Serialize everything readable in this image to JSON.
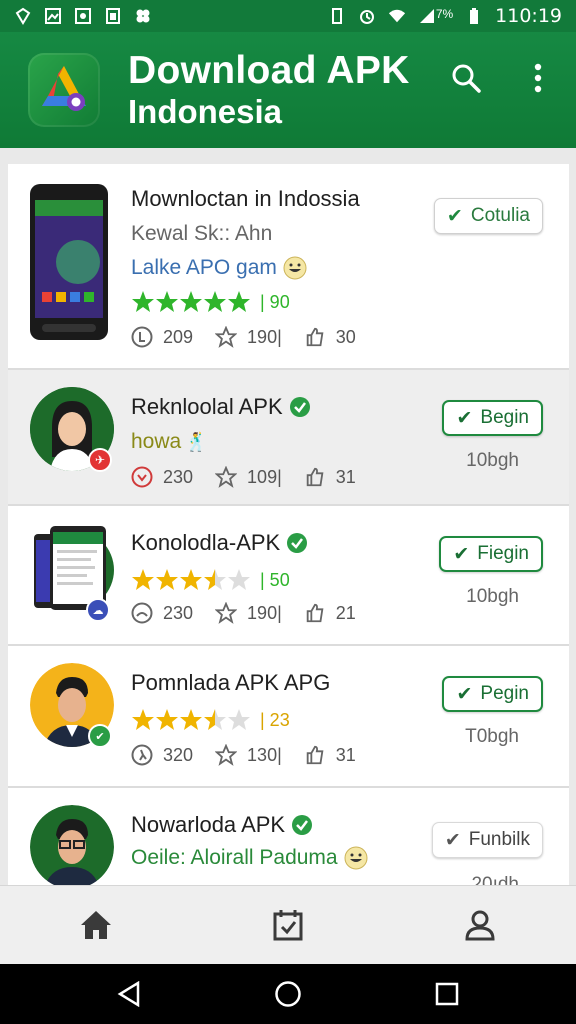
{
  "status_bar": {
    "battery_percent": "7%",
    "time": "110:19"
  },
  "app_bar": {
    "title_line1": "Download APK",
    "title_line2": "Indonesia",
    "icons": [
      "search-icon",
      "more-vert-icon"
    ]
  },
  "colors": {
    "brand_green": "#168943",
    "star_green": "#2fb52b",
    "star_gold": "#f0b400"
  },
  "items": [
    {
      "name": "Mownloctan in Indossia",
      "subtitle": "Kewal Sk:: Ahn",
      "tagline": "Lalke APO gam",
      "rating": "| 90",
      "stars": 5,
      "stats": [
        "209",
        "190|",
        "30"
      ],
      "button": "Cotulia",
      "size": ""
    },
    {
      "name": "Reknloolal APK",
      "tagline": "howa",
      "stats": [
        "230",
        "109|",
        "31"
      ],
      "button": "Begin",
      "size": "10bgh"
    },
    {
      "name": "Konolodla-APK",
      "rating": "| 50",
      "stars": 3.5,
      "stats": [
        "230",
        "190|",
        "21"
      ],
      "button": "Fiegin",
      "size": "10bgh"
    },
    {
      "name": "Pomnlada APK APG",
      "rating": "| 23",
      "stars": 3.5,
      "stats": [
        "320",
        "130|",
        "31"
      ],
      "button": "Pegin",
      "size": "T0bgh"
    },
    {
      "name": "Nowarloda APK",
      "tagline": "Oeile: Aloirall Paduma",
      "button": "Funbilk",
      "size": "20ıdh"
    }
  ],
  "bottom_nav": [
    "home-icon",
    "calendar-icon",
    "profile-icon"
  ],
  "system_nav": [
    "back-icon",
    "home-circle-icon",
    "recents-icon"
  ]
}
